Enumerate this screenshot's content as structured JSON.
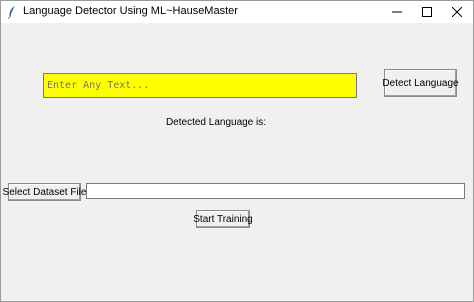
{
  "window": {
    "title": "Language Detector Using ML~HauseMaster",
    "app_icon": "feather-icon",
    "controls": [
      "minimize-icon",
      "maximize-icon",
      "close-icon"
    ]
  },
  "main": {
    "text_input": {
      "placeholder": "Enter Any Text...",
      "value": "",
      "background": "#ffff00"
    },
    "detect_button_label": "Detect Language",
    "result_label": "Detected Language is:",
    "select_dataset_button_label": "Select Dataset File",
    "dataset_path_value": "",
    "start_training_button_label": "Start Training"
  }
}
